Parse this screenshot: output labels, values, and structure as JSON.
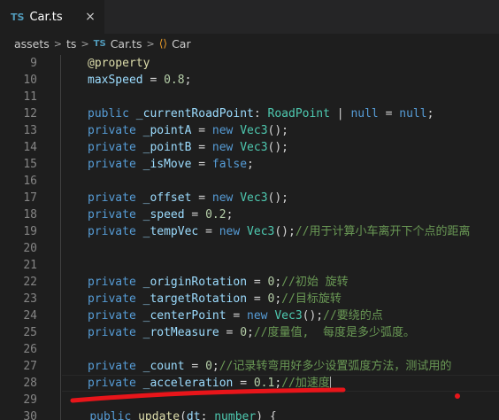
{
  "tab": {
    "badge": "TS",
    "title": "Car.ts",
    "close": "×"
  },
  "breadcrumb": {
    "folder1": "assets",
    "sep": ">",
    "folder2": "ts",
    "file_badge": "TS",
    "file": "Car.ts",
    "class_icon": "⟨⟩",
    "symbol": "Car"
  },
  "lines": [
    {
      "n": "9",
      "tokens": [
        [
          "dec",
          "@property"
        ]
      ]
    },
    {
      "n": "10",
      "tokens": [
        [
          "prop",
          "maxSpeed"
        ],
        [
          "plain",
          " = "
        ],
        [
          "num",
          "0.8"
        ],
        [
          "plain",
          ";"
        ]
      ]
    },
    {
      "n": "11",
      "tokens": []
    },
    {
      "n": "12",
      "tokens": [
        [
          "kw",
          "public"
        ],
        [
          "plain",
          " "
        ],
        [
          "prop",
          "_currentRoadPoint"
        ],
        [
          "plain",
          ": "
        ],
        [
          "type",
          "RoadPoint"
        ],
        [
          "plain",
          " | "
        ],
        [
          "kw",
          "null"
        ],
        [
          "plain",
          " = "
        ],
        [
          "kw",
          "null"
        ],
        [
          "plain",
          ";"
        ]
      ]
    },
    {
      "n": "13",
      "tokens": [
        [
          "kw",
          "private"
        ],
        [
          "plain",
          " "
        ],
        [
          "prop",
          "_pointA"
        ],
        [
          "plain",
          " = "
        ],
        [
          "kw",
          "new"
        ],
        [
          "plain",
          " "
        ],
        [
          "type",
          "Vec3"
        ],
        [
          "plain",
          "();"
        ]
      ]
    },
    {
      "n": "14",
      "tokens": [
        [
          "kw",
          "private"
        ],
        [
          "plain",
          " "
        ],
        [
          "prop",
          "_pointB"
        ],
        [
          "plain",
          " = "
        ],
        [
          "kw",
          "new"
        ],
        [
          "plain",
          " "
        ],
        [
          "type",
          "Vec3"
        ],
        [
          "plain",
          "();"
        ]
      ]
    },
    {
      "n": "15",
      "tokens": [
        [
          "kw",
          "private"
        ],
        [
          "plain",
          " "
        ],
        [
          "prop",
          "_isMove"
        ],
        [
          "plain",
          " = "
        ],
        [
          "kw",
          "false"
        ],
        [
          "plain",
          ";"
        ]
      ]
    },
    {
      "n": "16",
      "tokens": []
    },
    {
      "n": "17",
      "tokens": [
        [
          "kw",
          "private"
        ],
        [
          "plain",
          " "
        ],
        [
          "prop",
          "_offset"
        ],
        [
          "plain",
          " = "
        ],
        [
          "kw",
          "new"
        ],
        [
          "plain",
          " "
        ],
        [
          "type",
          "Vec3"
        ],
        [
          "plain",
          "();"
        ]
      ]
    },
    {
      "n": "18",
      "tokens": [
        [
          "kw",
          "private"
        ],
        [
          "plain",
          " "
        ],
        [
          "prop",
          "_speed"
        ],
        [
          "plain",
          " = "
        ],
        [
          "num",
          "0.2"
        ],
        [
          "plain",
          ";"
        ]
      ]
    },
    {
      "n": "19",
      "tokens": [
        [
          "kw",
          "private"
        ],
        [
          "plain",
          " "
        ],
        [
          "prop",
          "_tempVec"
        ],
        [
          "plain",
          " = "
        ],
        [
          "kw",
          "new"
        ],
        [
          "plain",
          " "
        ],
        [
          "type",
          "Vec3"
        ],
        [
          "plain",
          "();"
        ],
        [
          "cmt",
          "//用于计算小车离开下个点的距离"
        ]
      ]
    },
    {
      "n": "20",
      "tokens": []
    },
    {
      "n": "21",
      "tokens": []
    },
    {
      "n": "22",
      "tokens": [
        [
          "kw",
          "private"
        ],
        [
          "plain",
          " "
        ],
        [
          "prop",
          "_originRotation"
        ],
        [
          "plain",
          " = "
        ],
        [
          "num",
          "0"
        ],
        [
          "plain",
          ";"
        ],
        [
          "cmt",
          "//初始 旋转"
        ]
      ]
    },
    {
      "n": "23",
      "tokens": [
        [
          "kw",
          "private"
        ],
        [
          "plain",
          " "
        ],
        [
          "prop",
          "_targetRotation"
        ],
        [
          "plain",
          " = "
        ],
        [
          "num",
          "0"
        ],
        [
          "plain",
          ";"
        ],
        [
          "cmt",
          "//目标旋转"
        ]
      ]
    },
    {
      "n": "24",
      "tokens": [
        [
          "kw",
          "private"
        ],
        [
          "plain",
          " "
        ],
        [
          "prop",
          "_centerPoint"
        ],
        [
          "plain",
          " = "
        ],
        [
          "kw",
          "new"
        ],
        [
          "plain",
          " "
        ],
        [
          "type",
          "Vec3"
        ],
        [
          "plain",
          "();"
        ],
        [
          "cmt",
          "//要绕的点"
        ]
      ]
    },
    {
      "n": "25",
      "tokens": [
        [
          "kw",
          "private"
        ],
        [
          "plain",
          " "
        ],
        [
          "prop",
          "_rotMeasure"
        ],
        [
          "plain",
          " = "
        ],
        [
          "num",
          "0"
        ],
        [
          "plain",
          ";"
        ],
        [
          "cmt",
          "//度量值,  每度是多少弧度。"
        ]
      ]
    },
    {
      "n": "26",
      "tokens": []
    },
    {
      "n": "27",
      "tokens": [
        [
          "kw",
          "private"
        ],
        [
          "plain",
          " "
        ],
        [
          "prop",
          "_count"
        ],
        [
          "plain",
          " = "
        ],
        [
          "num",
          "0"
        ],
        [
          "plain",
          ";"
        ],
        [
          "cmt",
          "//记录转弯用好多少设置弧度方法，测试用的"
        ]
      ]
    },
    {
      "n": "28",
      "tokens": [
        [
          "kw",
          "private"
        ],
        [
          "plain",
          " "
        ],
        [
          "prop",
          "_acceleration"
        ],
        [
          "plain",
          " = "
        ],
        [
          "num",
          "0.1"
        ],
        [
          "plain",
          ";"
        ],
        [
          "cmt",
          "//加速度"
        ]
      ]
    },
    {
      "n": "29",
      "tokens": []
    },
    {
      "n": "30",
      "tokens": [
        [
          "plain",
          "    "
        ],
        [
          "kw",
          "public"
        ],
        [
          "plain",
          " "
        ],
        [
          "fn",
          "update"
        ],
        [
          "plain",
          "("
        ],
        [
          "prop",
          "dt"
        ],
        [
          "plain",
          ": "
        ],
        [
          "type",
          "number"
        ],
        [
          "plain",
          ") {"
        ]
      ]
    }
  ],
  "current_line": "28",
  "colors": {
    "annotation": "#e8151a",
    "background": "#1e1e1e",
    "accent": "#519aba"
  }
}
